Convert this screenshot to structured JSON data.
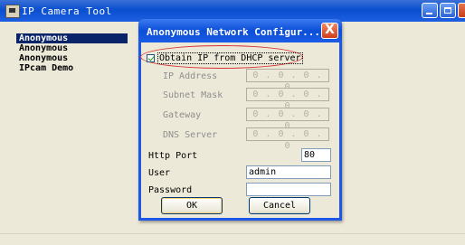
{
  "main_window": {
    "title": "IP Camera Tool",
    "cameras": [
      "Anonymous",
      "Anonymous",
      "Anonymous",
      "IPcam Demo"
    ],
    "selected_index": 0
  },
  "dialog": {
    "title": "Anonymous Network Configur...",
    "close_label": "X",
    "dhcp": {
      "label": "Obtain IP from DHCP server",
      "checked": true
    },
    "disabled_fields": [
      {
        "label": "IP Address",
        "value": "0 . 0 . 0 . 0"
      },
      {
        "label": "Subnet Mask",
        "value": "0 . 0 . 0 . 0"
      },
      {
        "label": "Gateway",
        "value": "0 . 0 . 0 . 0"
      },
      {
        "label": "DNS Server",
        "value": "0 . 0 . 0 . 0"
      }
    ],
    "http_port": {
      "label": "Http Port",
      "value": "80"
    },
    "user": {
      "label": "User",
      "value": "admin"
    },
    "password": {
      "label": "Password",
      "value": ""
    },
    "ok_label": "OK",
    "cancel_label": "Cancel"
  },
  "colors": {
    "titlebar_blue": "#0a4fd0",
    "selection": "#0a246a",
    "highlight_circle": "#d83030",
    "dialog_face": "#ece9d8"
  }
}
